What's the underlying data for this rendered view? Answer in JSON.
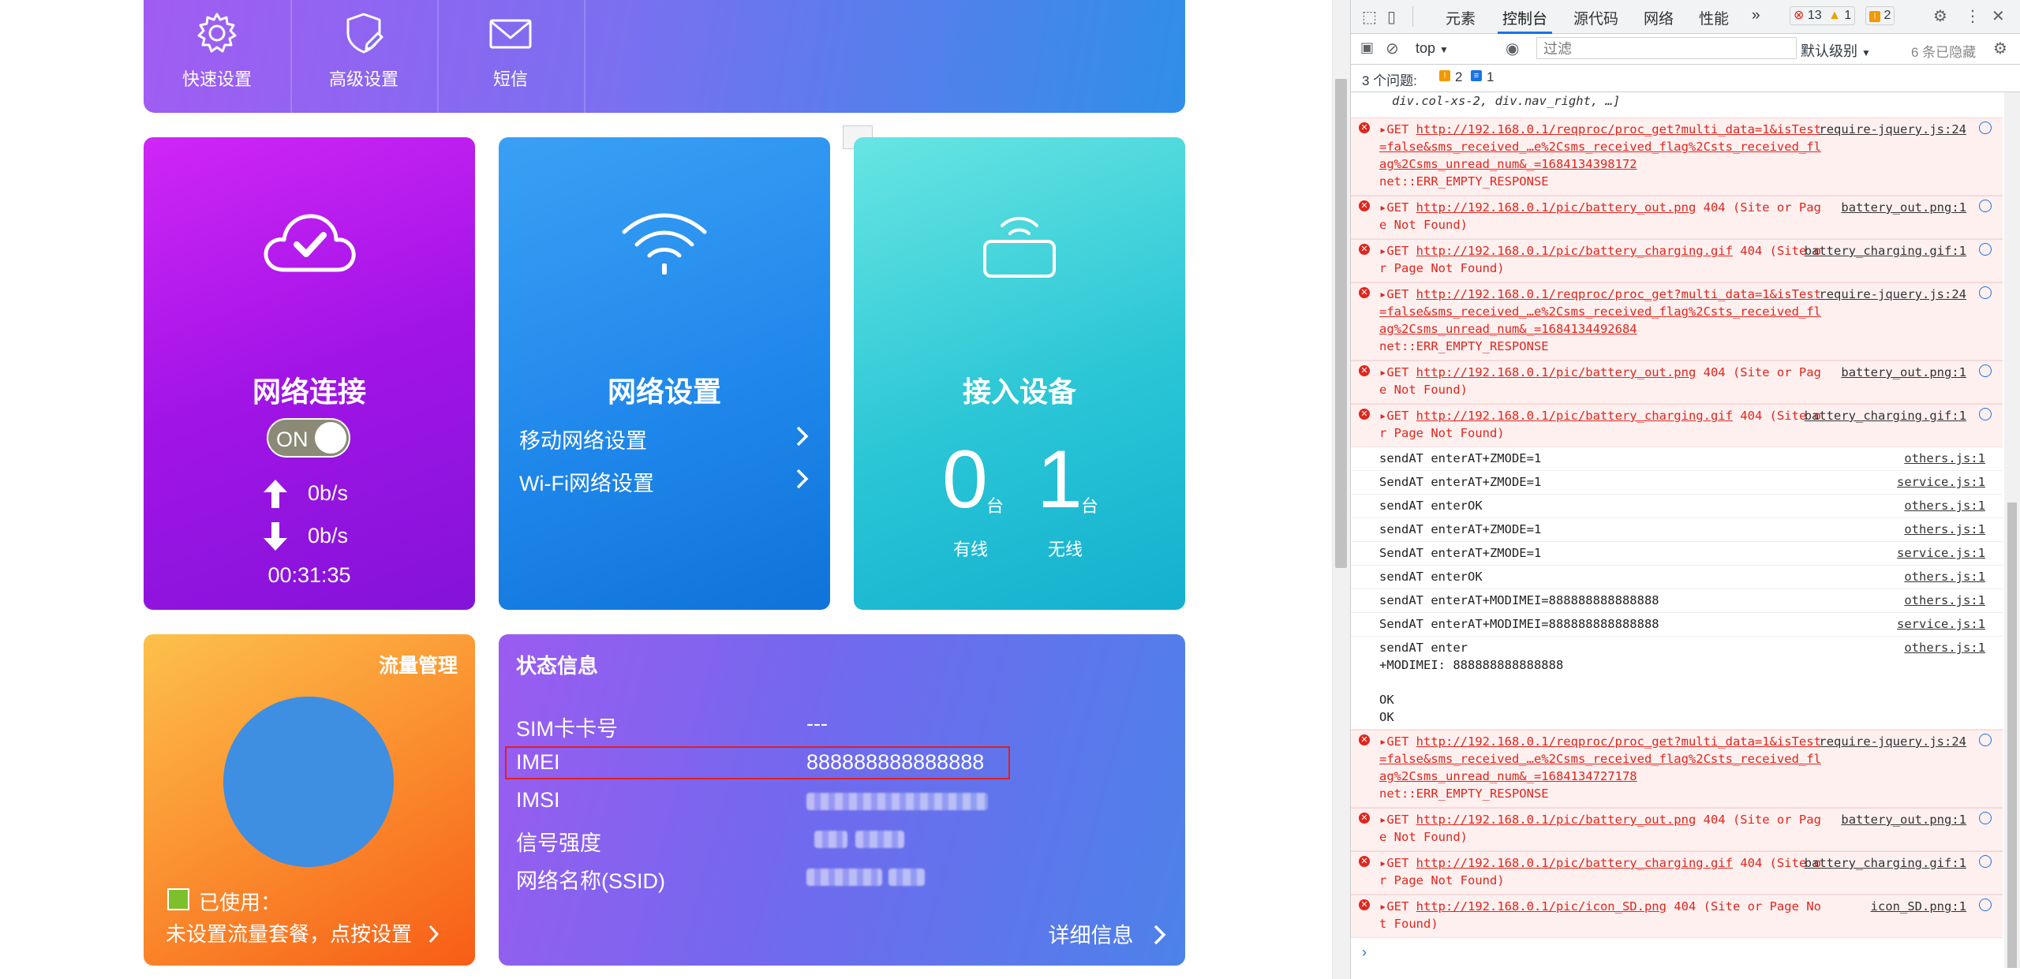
{
  "topnav": {
    "items": [
      {
        "label": "快速设置",
        "icon": "gear-icon"
      },
      {
        "label": "高级设置",
        "icon": "shield-edit-icon"
      },
      {
        "label": "短信",
        "icon": "envelope-icon"
      }
    ]
  },
  "network_connection": {
    "title": "网络连接",
    "toggle_label": "ON",
    "upload": "0b/s",
    "download": "0b/s",
    "duration": "00:31:35"
  },
  "network_settings": {
    "title": "网络设置",
    "items": [
      "移动网络设置",
      "Wi-Fi网络设置"
    ]
  },
  "devices": {
    "title": "接入设备",
    "wired_count": "0",
    "wireless_count": "1",
    "unit": "台",
    "wired_label": "有线",
    "wireless_label": "无线"
  },
  "traffic": {
    "title": "流量管理",
    "used_label": "已使用：",
    "setup_hint": "未设置流量套餐，点按设置",
    "used_fraction": 0
  },
  "status": {
    "title": "状态信息",
    "rows": [
      {
        "key": "SIM卡卡号",
        "value": "---"
      },
      {
        "key": "IMEI",
        "value": "888888888888888"
      },
      {
        "key": "IMSI",
        "value": ""
      },
      {
        "key": "信号强度",
        "value": ""
      },
      {
        "key": "网络名称(SSID)",
        "value": ""
      }
    ],
    "detail_link": "详细信息"
  },
  "devtools": {
    "tabs": [
      "元素",
      "控制台",
      "源代码",
      "网络",
      "性能"
    ],
    "active_tab": "控制台",
    "more": "»",
    "error_count": "13",
    "warning_count": "1",
    "issue_badge": "2",
    "context": "top",
    "filter_placeholder": "过滤",
    "level": "默认级别",
    "hidden": "6 条已隐藏",
    "issues_label": "3 个问题:",
    "issues_warn": "2",
    "issues_info": "1",
    "prev_line": "div.col-xs-2, div.nav_right, …]",
    "entries": [
      {
        "type": "err",
        "method": "GET",
        "url": "http://192.168.0.1/reqproc/proc_get?multi_data=1&isTest=false&sms_received_…e%2Csms_received_flag%2Csts_received_flag%2Csms_unread_num&_=1684134398172",
        "msg": "net::ERR_EMPTY_RESPONSE",
        "src": "require-jquery.js:24"
      },
      {
        "type": "err",
        "method": "GET",
        "url": "http://192.168.0.1/pic/battery_out.png",
        "msg": "404 (Site or Page Not Found)",
        "src": "battery_out.png:1"
      },
      {
        "type": "err",
        "method": "GET",
        "url": "http://192.168.0.1/pic/battery_charging.gif",
        "msg": "404 (Site or Page Not Found)",
        "src": "battery_charging.gif:1"
      },
      {
        "type": "err",
        "method": "GET",
        "url": "http://192.168.0.1/reqproc/proc_get?multi_data=1&isTest=false&sms_received_…e%2Csms_received_flag%2Csts_received_flag%2Csms_unread_num&_=1684134492684",
        "msg": "net::ERR_EMPTY_RESPONSE",
        "src": "require-jquery.js:24"
      },
      {
        "type": "err",
        "method": "GET",
        "url": "http://192.168.0.1/pic/battery_out.png",
        "msg": "404 (Site or Page Not Found)",
        "src": "battery_out.png:1"
      },
      {
        "type": "err",
        "method": "GET",
        "url": "http://192.168.0.1/pic/battery_charging.gif",
        "msg": "404 (Site or Page Not Found)",
        "src": "battery_charging.gif:1"
      },
      {
        "type": "info",
        "text": "sendAT enterAT+ZMODE=1",
        "src": "others.js:1"
      },
      {
        "type": "info",
        "text": "SendAT enterAT+ZMODE=1",
        "src": "service.js:1"
      },
      {
        "type": "info",
        "text": "sendAT enterOK",
        "src": "others.js:1"
      },
      {
        "type": "info",
        "text": "sendAT enterAT+ZMODE=1",
        "src": "others.js:1"
      },
      {
        "type": "info",
        "text": "SendAT enterAT+ZMODE=1",
        "src": "service.js:1"
      },
      {
        "type": "info",
        "text": "sendAT enterOK",
        "src": "others.js:1"
      },
      {
        "type": "info",
        "text": "sendAT enterAT+MODIMEI=888888888888888",
        "src": "others.js:1"
      },
      {
        "type": "info",
        "text": "SendAT enterAT+MODIMEI=888888888888888",
        "src": "service.js:1"
      },
      {
        "type": "info",
        "text": "sendAT enter\n+MODIMEI: 888888888888888\n\nOK\nOK",
        "src": "others.js:1"
      },
      {
        "type": "err",
        "method": "GET",
        "url": "http://192.168.0.1/reqproc/proc_get?multi_data=1&isTest=false&sms_received_…e%2Csms_received_flag%2Csts_received_flag%2Csms_unread_num&_=1684134727178",
        "msg": "net::ERR_EMPTY_RESPONSE",
        "src": "require-jquery.js:24"
      },
      {
        "type": "err",
        "method": "GET",
        "url": "http://192.168.0.1/pic/battery_out.png",
        "msg": "404 (Site or Page Not Found)",
        "src": "battery_out.png:1"
      },
      {
        "type": "err",
        "method": "GET",
        "url": "http://192.168.0.1/pic/battery_charging.gif",
        "msg": "404 (Site or Page Not Found)",
        "src": "battery_charging.gif:1"
      },
      {
        "type": "err",
        "method": "GET",
        "url": "http://192.168.0.1/pic/icon_SD.png",
        "msg": "404 (Site or Page Not Found)",
        "src": "icon_SD.png:1"
      }
    ],
    "prompt": "›"
  }
}
